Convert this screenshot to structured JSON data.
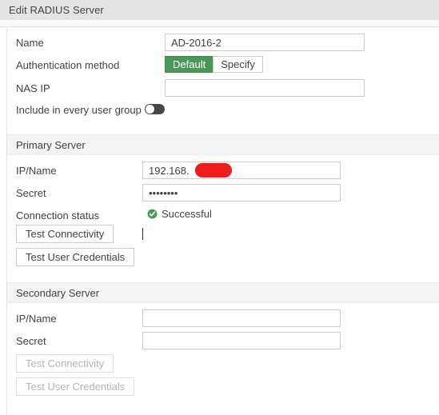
{
  "dialog": {
    "title": "Edit RADIUS Server"
  },
  "general": {
    "name_label": "Name",
    "name_value": "AD-2016-2",
    "auth_method_label": "Authentication method",
    "auth_options": [
      {
        "label": "Default",
        "selected": true
      },
      {
        "label": "Specify",
        "selected": false
      }
    ],
    "auth_default_label": "Default",
    "auth_specify_label": "Specify",
    "nas_ip_label": "NAS IP",
    "nas_ip_value": "",
    "include_group_label": "Include in every user group",
    "include_group_state": "off"
  },
  "primary": {
    "section_title": "Primary Server",
    "ip_name_label": "IP/Name",
    "ip_name_value": "192.168.",
    "ip_name_redacted": true,
    "secret_label": "Secret",
    "secret_value": "••••••••",
    "secret_dot_count": 8,
    "connection_status_label": "Connection status",
    "connection_status_value": "Successful",
    "connection_status_icon": "check-circle-icon",
    "connection_status_color": "#4a9758",
    "test_connectivity_label": "Test Connectivity",
    "test_user_credentials_label": "Test User Credentials",
    "buttons_enabled": true
  },
  "secondary": {
    "section_title": "Secondary Server",
    "ip_name_label": "IP/Name",
    "ip_name_value": "",
    "secret_label": "Secret",
    "secret_value": "",
    "test_connectivity_label": "Test Connectivity",
    "test_user_credentials_label": "Test User Credentials",
    "buttons_enabled": false
  },
  "colors": {
    "accent_green": "#4a9758",
    "titlebar_bg": "#e4e4e4",
    "section_bg": "#f4f4f4",
    "redaction_red": "#ee1b1b",
    "text": "#3e4348"
  }
}
